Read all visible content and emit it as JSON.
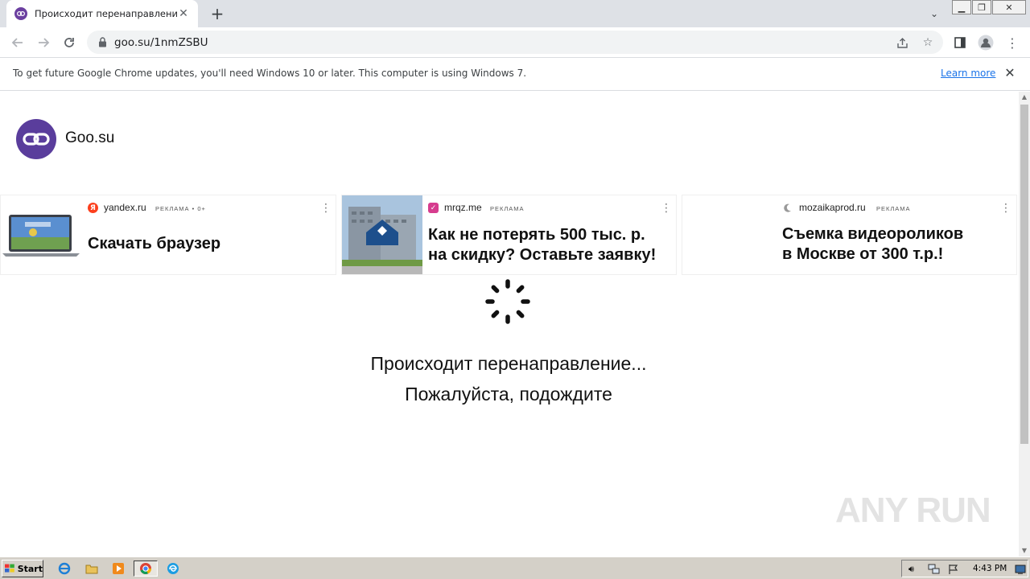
{
  "browser": {
    "tab": {
      "title": "Происходит перенаправление"
    },
    "address": {
      "url": "goo.su/1nmZSBU"
    },
    "infobar": {
      "message": "To get future Google Chrome updates, you'll need Windows 10 or later. This computer is using Windows 7.",
      "link": "Learn more"
    }
  },
  "site": {
    "name": "Goo.su"
  },
  "ads": [
    {
      "domain": "yandex.ru",
      "label": "РЕКЛАМА • 0+",
      "title": "Скачать браузер"
    },
    {
      "domain": "mrqz.me",
      "label": "РЕКЛАМА",
      "title_line1": "Как не потерять 500 тыс. р.",
      "title_line2": "на скидку? Оставьте заявку!"
    },
    {
      "domain": "mozaikaprod.ru",
      "label": "РЕКЛАМА",
      "title_line1": "Съемка видеороликов",
      "title_line2": "в Москве от 300 т.р.!"
    }
  ],
  "redirect": {
    "title": "Происходит перенаправление...",
    "subtitle": "Пожалуйста, подождите"
  },
  "watermark": "ANY RUN",
  "taskbar": {
    "start": "Start",
    "clock": "4:43 PM"
  },
  "colors": {
    "brand": "#5a3d9c",
    "link": "#1a73e8",
    "tab_strip": "#dee1e6"
  }
}
